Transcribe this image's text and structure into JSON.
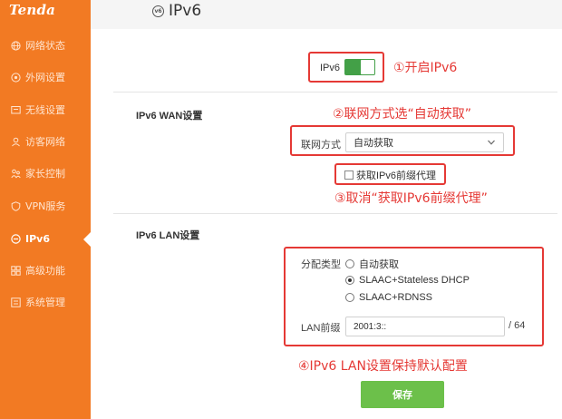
{
  "brand": {
    "logo": "Tenda",
    "accent": "#f27a23"
  },
  "sidebar": {
    "items": [
      {
        "label": "网络状态",
        "icon": "globe-icon"
      },
      {
        "label": "外网设置",
        "icon": "internet-icon"
      },
      {
        "label": "无线设置",
        "icon": "wireless-icon"
      },
      {
        "label": "访客网络",
        "icon": "guest-icon"
      },
      {
        "label": "家长控制",
        "icon": "parental-icon"
      },
      {
        "label": "VPN服务",
        "icon": "vpn-icon"
      },
      {
        "label": "IPv6",
        "icon": "ipv6-icon",
        "active": true
      },
      {
        "label": "高级功能",
        "icon": "advanced-icon"
      },
      {
        "label": "系统管理",
        "icon": "system-icon"
      }
    ]
  },
  "header": {
    "title": "IPv6",
    "icon_text": "v6"
  },
  "ipv6_switch": {
    "label": "IPv6",
    "enabled": true
  },
  "wan": {
    "title": "IPv6 WAN设置",
    "mode_label": "联网方式",
    "mode_value": "自动获取",
    "prefix_delegation_label": "获取IPv6前缀代理",
    "prefix_delegation_checked": false
  },
  "lan": {
    "title": "IPv6 LAN设置",
    "type_label": "分配类型",
    "options": [
      {
        "label": "自动获取",
        "checked": false
      },
      {
        "label": "SLAAC+Stateless DHCP",
        "checked": true
      },
      {
        "label": "SLAAC+RDNSS",
        "checked": false
      }
    ],
    "prefix_label": "LAN前缀",
    "prefix_value": "2001:3::",
    "prefix_length": "/ 64"
  },
  "save_label": "保存",
  "annotations": {
    "step1": "①开启IPv6",
    "step2": "②联网方式选“自动获取”",
    "step3": "③取消“获取IPv6前缀代理”",
    "step4": "④IPv6 LAN设置保持默认配置",
    "color": "#e53935"
  }
}
